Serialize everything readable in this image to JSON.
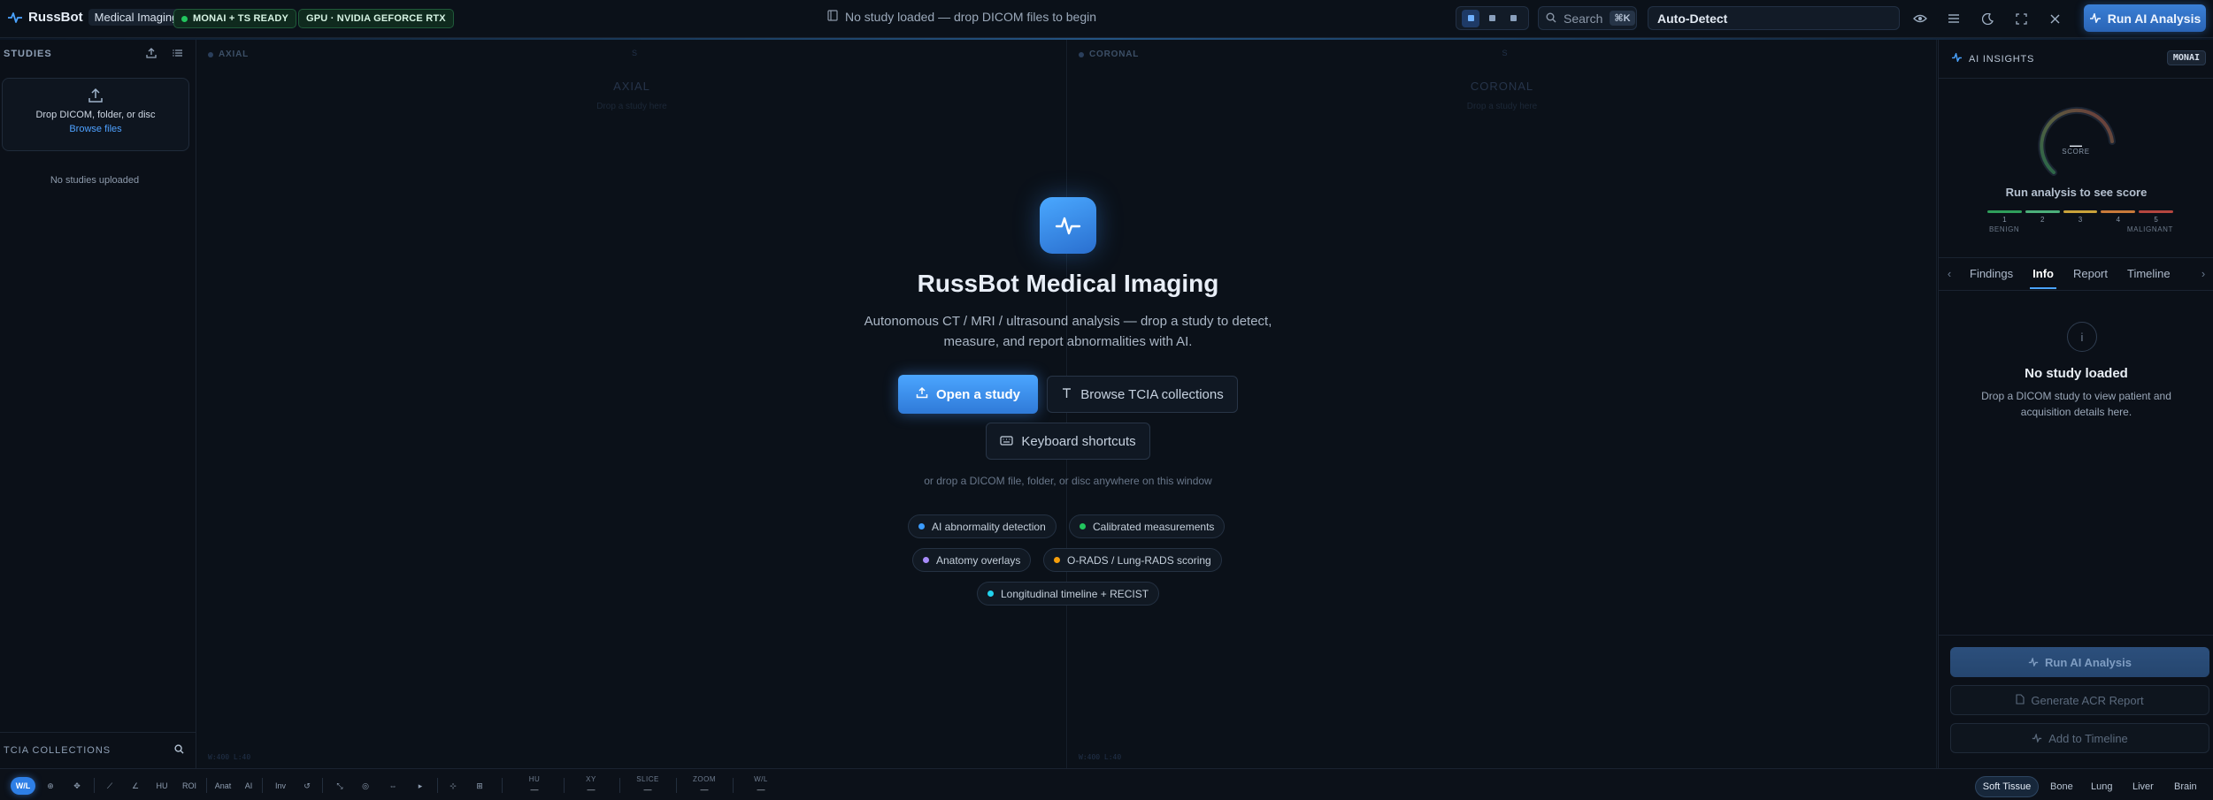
{
  "app": {
    "name": "RussBot",
    "subtitle": "Medical Imaging",
    "status_monai": "MONAI + TS READY",
    "status_gpu": "GPU · NVIDIA GEFORCE RTX",
    "center_status": "No study loaded — drop DICOM files to begin",
    "search_placeholder": "Search",
    "search_kbd": "⌘K",
    "modality_select": "Auto-Detect",
    "run_button": "Run AI Analysis"
  },
  "sidebar": {
    "title": "STUDIES",
    "drop_text": "Drop DICOM, folder, or disc",
    "browse_link": "Browse files",
    "empty_text": "No studies uploaded",
    "tcia_title": "TCIA COLLECTIONS"
  },
  "viewports": [
    {
      "label": "AXIAL",
      "ghost": "AXIAL",
      "ghost_sub": "Drop a study here",
      "top_mark": "S",
      "bottom_mark": "W:400 L:40"
    },
    {
      "label": "CORONAL",
      "ghost": "CORONAL",
      "ghost_sub": "Drop a study here",
      "top_mark": "S",
      "bottom_mark": "W:400 L:40"
    }
  ],
  "welcome": {
    "title": "RussBot Medical Imaging",
    "desc_line1": "Autonomous CT / MRI / ultrasound analysis — drop a study to detect,",
    "desc_line2": "measure, and report abnormalities with AI.",
    "open_button": "Open a study",
    "tcia_button": "Browse TCIA collections",
    "keys_button": "Keyboard shortcuts",
    "hint": "or drop a DICOM file, folder, or disc anywhere on this window",
    "chips": [
      {
        "label": "AI abnormality detection",
        "color": "#3b9cff"
      },
      {
        "label": "Calibrated measurements",
        "color": "#22c55e"
      },
      {
        "label": "Anatomy overlays",
        "color": "#a78bfa"
      },
      {
        "label": "O-RADS / Lung-RADS scoring",
        "color": "#f59e0b"
      },
      {
        "label": "Longitudinal timeline + RECIST",
        "color": "#22d3ee"
      }
    ]
  },
  "insights": {
    "title": "AI INSIGHTS",
    "badge": "MONAI",
    "score_value": "—",
    "score_label": "SCORE",
    "caption": "Run analysis to see score",
    "scale_nums": [
      "1",
      "2",
      "3",
      "4",
      "5"
    ],
    "scale_colors": [
      "#2f9e5b",
      "#4caf7a",
      "#c9a23a",
      "#c97a3a",
      "#b5463f"
    ],
    "scale_low": "BENIGN",
    "scale_high": "MALIGNANT",
    "tabs": [
      "Findings",
      "Info",
      "Report",
      "Timeline"
    ],
    "active_tab": "Info",
    "empty_icon": "i",
    "empty_title": "No study loaded",
    "empty_line1": "Drop a DICOM study to view patient and",
    "empty_line2": "acquisition details here.",
    "run_button": "Run AI Analysis",
    "report_button": "Generate ACR Report",
    "timeline_button": "Add to Timeline"
  },
  "toolbar": {
    "tools": [
      "W/L",
      "⊕",
      "✥",
      "⟋",
      "∠",
      "HU",
      "ROI",
      "Anat",
      "AI",
      "Inv",
      "↺",
      "⤡",
      "◎",
      "⇔",
      "▸",
      "⊹",
      "⊞"
    ],
    "readouts": [
      {
        "label": "HU",
        "value": "—"
      },
      {
        "label": "XY",
        "value": "—"
      },
      {
        "label": "SLICE",
        "value": "—"
      },
      {
        "label": "ZOOM",
        "value": "—"
      },
      {
        "label": "W/L",
        "value": "—"
      }
    ],
    "presets": [
      "Soft Tissue",
      "Bone",
      "Lung",
      "Liver",
      "Brain"
    ],
    "active_preset": "Soft Tissue"
  }
}
